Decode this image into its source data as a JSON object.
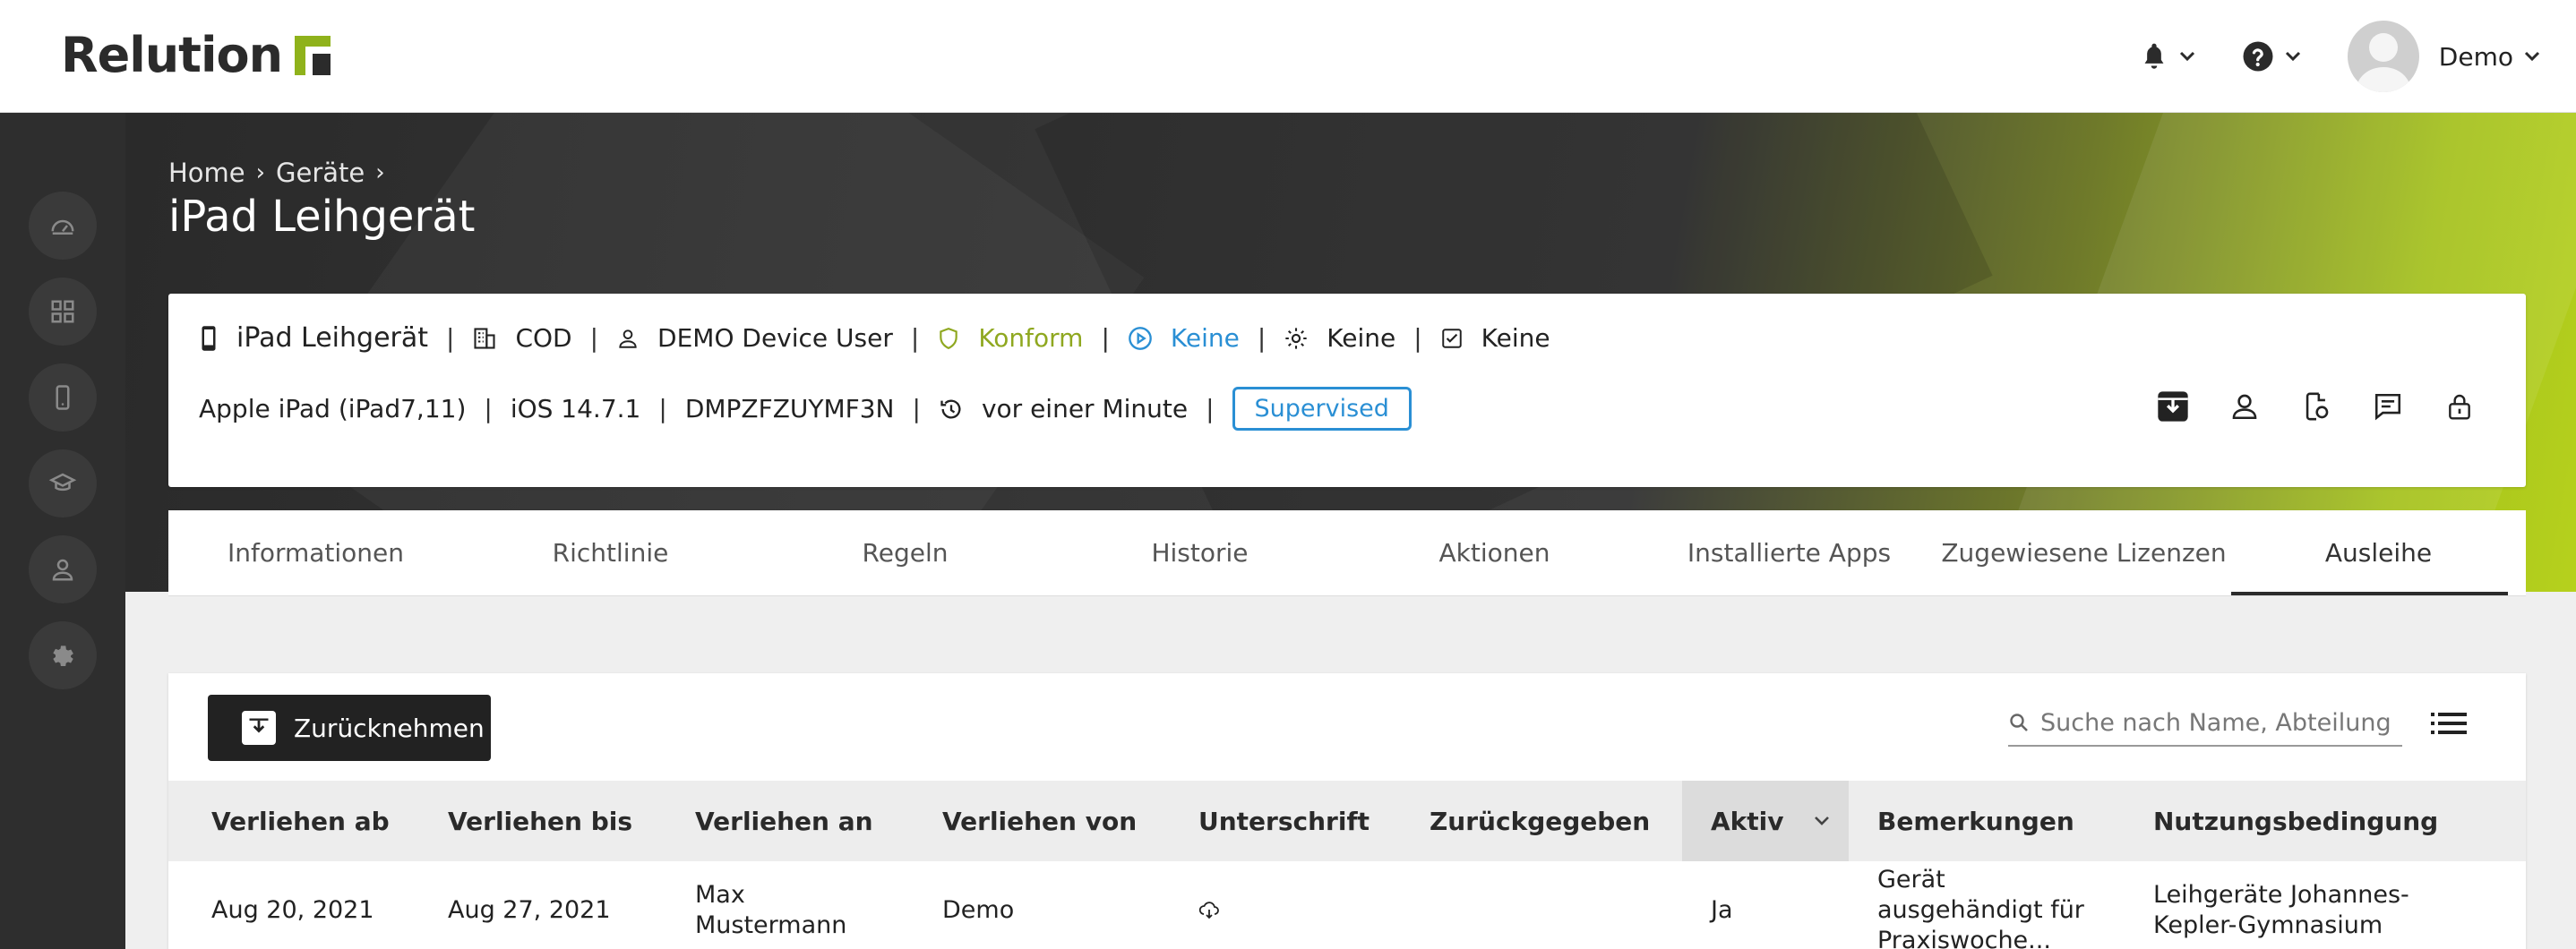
{
  "app": {
    "logo_text": "Relution"
  },
  "header": {
    "user_name": "Demo"
  },
  "breadcrumb": {
    "home": "Home",
    "devices": "Geräte"
  },
  "page": {
    "title": "iPad Leihgerät"
  },
  "device": {
    "name": "iPad Leihgerät",
    "ownership": "COD",
    "user": "DEMO Device User",
    "compliance": "Konform",
    "policy": "Keine",
    "config": "Keine",
    "tasks": "Keine",
    "model": "Apple iPad (iPad7,11)",
    "os": "iOS 14.7.1",
    "serial": "DMPZFZUYMF3N",
    "last_seen": "vor einer Minute",
    "badge": "Supervised"
  },
  "tabs": [
    {
      "label": "Informationen"
    },
    {
      "label": "Richtlinie"
    },
    {
      "label": "Regeln"
    },
    {
      "label": "Historie"
    },
    {
      "label": "Aktionen"
    },
    {
      "label": "Installierte Apps"
    },
    {
      "label": "Zugewiesene Lizenzen"
    },
    {
      "label": "Ausleihe"
    }
  ],
  "loan": {
    "return_label": "Zurücknehmen",
    "search_placeholder": "Suche nach Name, Abteilung o...",
    "columns": [
      "Verliehen ab",
      "Verliehen bis",
      "Verliehen an",
      "Verliehen von",
      "Unterschrift",
      "Zurückgegeben",
      "Aktiv",
      "Bemerkungen",
      "Nutzungsbedingung"
    ],
    "rows": [
      {
        "from": "Aug 20, 2021",
        "until": "Aug 27, 2021",
        "to": "Max Mustermann",
        "by": "Demo",
        "signature_icon": "cloud-download-icon",
        "returned": "",
        "active": "Ja",
        "remarks": "Gerät ausgehändigt für Praxiswoche...",
        "terms": "Leihgeräte Johannes-Kepler-Gymnasium"
      }
    ]
  },
  "colors": {
    "accent_green": "#8fb21b",
    "link_blue": "#2a8fd4",
    "dark": "#222222"
  }
}
